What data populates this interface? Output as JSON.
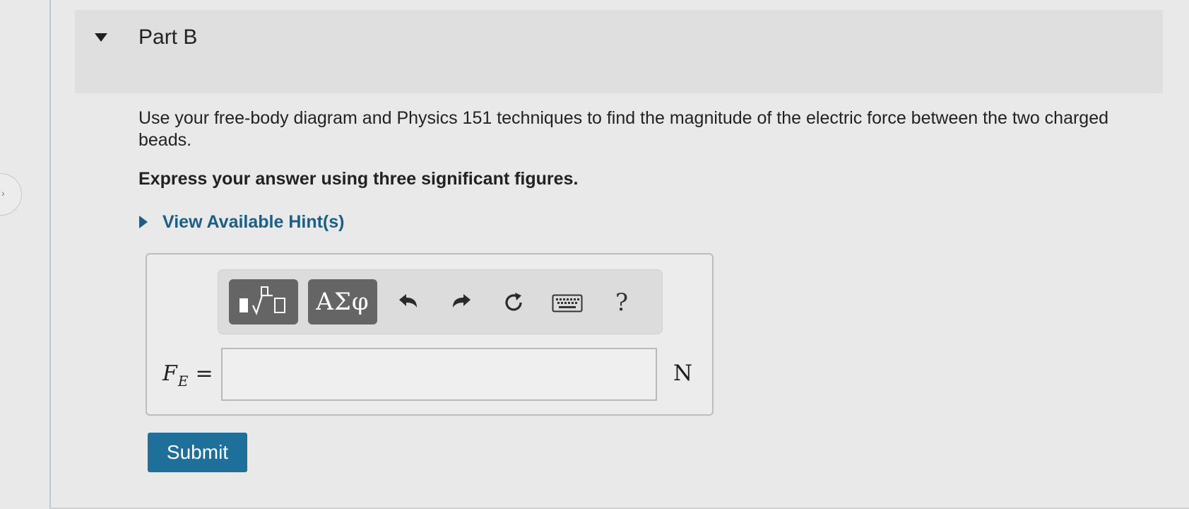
{
  "part": {
    "title": "Part B"
  },
  "question": {
    "prompt": "Use your free-body diagram and Physics 151 techniques to find the magnitude of the electric force between the two charged beads.",
    "instruction": "Express your answer using three significant figures."
  },
  "hints": {
    "toggle_label": "View Available Hint(s)"
  },
  "toolbar": {
    "greek_label": "ΑΣφ",
    "help_label": "?",
    "buttons": [
      "templates-icon",
      "greek-symbols-button",
      "undo-icon",
      "redo-icon",
      "reset-icon",
      "keyboard-icon",
      "help-button"
    ]
  },
  "answer": {
    "variable_symbol": "F",
    "variable_subscript": "E",
    "equals": "=",
    "value": "",
    "unit": "N"
  },
  "actions": {
    "submit_label": "Submit"
  },
  "colors": {
    "page_background": "#e9e9e9",
    "header_background": "#dfdfdf",
    "link_blue": "#1b5f85",
    "submit_blue": "#1f6f9b",
    "toolbar_dark_button": "#656565"
  }
}
